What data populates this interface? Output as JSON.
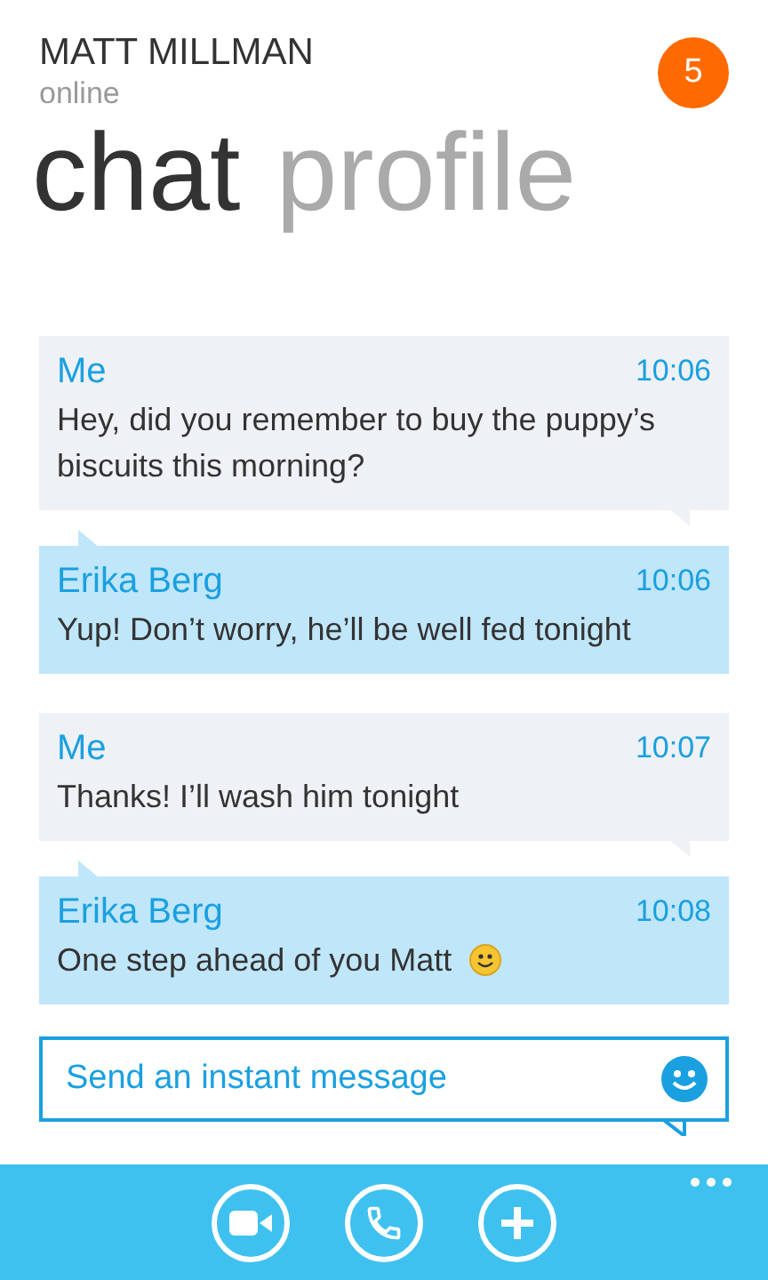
{
  "contact": {
    "name": "MATT MILLMAN",
    "status": "online",
    "badge": "5"
  },
  "tabs": [
    {
      "label": "chat",
      "selected": true
    },
    {
      "label": "profile",
      "selected": false
    }
  ],
  "messages": [
    {
      "kind": "me",
      "sender": "Me",
      "time": "10:06",
      "text": "Hey, did you remember to buy the puppy’s biscuits this morning?"
    },
    {
      "kind": "them",
      "sender": "Erika Berg",
      "time": "10:06",
      "text": "Yup! Don’t worry, he’ll be well fed tonight"
    },
    {
      "kind": "me",
      "sender": "Me",
      "time": "10:07",
      "text": "Thanks! I’ll wash him tonight"
    },
    {
      "kind": "them",
      "sender": "Erika Berg",
      "time": "10:08",
      "text": "One step ahead of you Matt",
      "emoji": true
    }
  ],
  "composer": {
    "placeholder": "Send an instant message"
  }
}
